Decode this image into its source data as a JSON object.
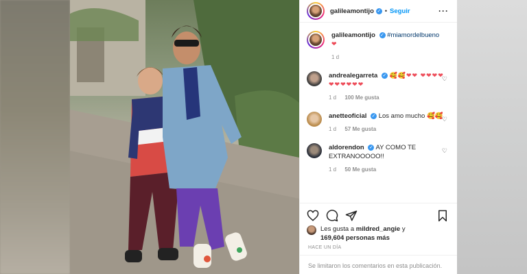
{
  "post": {
    "username": "galileamontijo",
    "follow_label": "Seguir",
    "caption": {
      "username": "galileamontijo",
      "hashtag": "#miamordelbueno",
      "emoji": "❤",
      "time": "1 d"
    },
    "comments": [
      {
        "username": "andrealegarreta",
        "verified": true,
        "text": "🥰🥰❤❤ ❤❤❤❤❤❤❤❤❤❤",
        "time": "1 d",
        "likes": "100 Me gusta"
      },
      {
        "username": "anetteoficial",
        "verified": true,
        "text": "Los amo mucho 🥰🥰",
        "time": "1 d",
        "likes": "57 Me gusta"
      },
      {
        "username": "aldorendon",
        "verified": true,
        "text": "AY COMO TE EXTRANOOOOO!!",
        "time": "1 d",
        "likes": "50 Me gusta"
      }
    ],
    "likes_text": {
      "prefix": "Les gusta a",
      "user": "mildred_angie",
      "middle": "y",
      "count": "169,604 personas más"
    },
    "posted": "HACE UN DÍA",
    "comments_limited": "Se limitaron los comentarios en esta publicación."
  },
  "icons": {
    "verified": "verified-badge-icon",
    "heart": "heart-icon",
    "comment": "comment-icon",
    "share": "share-icon",
    "save": "bookmark-icon",
    "more": "more-options-icon"
  },
  "colors": {
    "accent": "#0095f6",
    "verified": "#3897f0",
    "muted": "#8e8e8e",
    "like_red": "#ed4956"
  }
}
